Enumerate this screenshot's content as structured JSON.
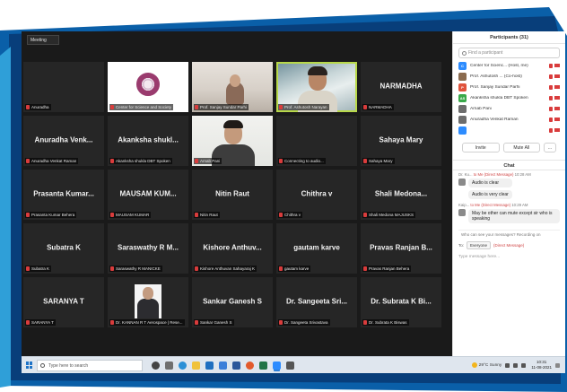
{
  "window": {
    "meeting_info_label": "Meeting"
  },
  "tiles": [
    {
      "name": "",
      "label": "Anuradha",
      "kind": "blank"
    },
    {
      "name": "",
      "label": "Center for Science and Society",
      "kind": "logo"
    },
    {
      "name": "",
      "label": "Prof. Sanjay Sundar Parhi",
      "kind": "video-room"
    },
    {
      "name": "",
      "label": "Prof. Ashutosh Narayan",
      "kind": "video-man",
      "speaking": true
    },
    {
      "name": "NARMADHA",
      "label": "NARMADHA",
      "kind": "name"
    },
    {
      "name": "Anuradha Venk...",
      "label": "Anuradha Venkat Raman",
      "kind": "name"
    },
    {
      "name": "Akanksha shukl...",
      "label": "Akanksha shukla DBT Spoken",
      "kind": "name"
    },
    {
      "name": "",
      "label": "Arnab Pani",
      "kind": "video-arnab"
    },
    {
      "name": "",
      "label": "Connecting to audio...",
      "kind": "blank"
    },
    {
      "name": "Sahaya Mary",
      "label": "Sahaya Mary",
      "kind": "name"
    },
    {
      "name": "Prasanta Kumar...",
      "label": "Prasanta Kumar Behera",
      "kind": "name"
    },
    {
      "name": "MAUSAM KUM...",
      "label": "MAUSAM KUMAR",
      "kind": "name"
    },
    {
      "name": "Nitin Raut",
      "label": "Nitin Raut",
      "kind": "name"
    },
    {
      "name": "Chithra v",
      "label": "Chithra v",
      "kind": "name"
    },
    {
      "name": "Shali Medona...",
      "label": "Shali Medona MAJUSKS",
      "kind": "name"
    },
    {
      "name": "Subatra K",
      "label": "Subatra K",
      "kind": "name"
    },
    {
      "name": "Saraswathy R M...",
      "label": "Saraswathy R MANICKE",
      "kind": "name"
    },
    {
      "name": "Kishore Anthuv...",
      "label": "Kishore Anthuvan Sahayaraj K",
      "kind": "name"
    },
    {
      "name": "gautam karve",
      "label": "gautam karve",
      "kind": "name"
    },
    {
      "name": "Pravas Ranjan B...",
      "label": "Pravas Ranjan Behera",
      "kind": "name"
    },
    {
      "name": "SARANYA T",
      "label": "SARANYA T",
      "kind": "name"
    },
    {
      "name": "",
      "label": "Dr. KANNAN R T Aerospace | Rese...",
      "kind": "photo"
    },
    {
      "name": "Sankar Ganesh S",
      "label": "Sankar Ganesh S",
      "kind": "name"
    },
    {
      "name": "Dr. Sangeeta Sri...",
      "label": "Dr. Sangeeta Srivastava",
      "kind": "name"
    },
    {
      "name": "Dr. Subrata K Bi...",
      "label": "Dr. Subrata K Biswas",
      "kind": "name"
    }
  ],
  "participants_panel": {
    "title": "Participants (31)",
    "search_placeholder": "Find a participant",
    "items": [
      {
        "initials": "C",
        "name": "Center for Scienc... (Host, me)",
        "color": "#2d8cff"
      },
      {
        "initials": "",
        "name": "Prof. Ashutosh ... (Co-host)",
        "color": "#8b6b4f"
      },
      {
        "initials": "P",
        "name": "Prof. Sanjay Sundar Parhi",
        "color": "#e0533c"
      },
      {
        "initials": "AS",
        "name": "Akanksha shukla DBT Spoken",
        "color": "#39a94a"
      },
      {
        "initials": "",
        "name": "Arnab Pani",
        "color": "#6d6d6d"
      },
      {
        "initials": "",
        "name": "Anuradha Venkat Raman",
        "color": "#6d6d6d"
      },
      {
        "initials": "",
        "name": "",
        "color": "#2d8cff"
      }
    ],
    "invite_label": "Invite",
    "mute_all_label": "Mute All",
    "more_label": "..."
  },
  "chat_panel": {
    "title": "Chat",
    "messages": [
      {
        "from": "Dr. Ku...",
        "to": "to Me (Direct Message)",
        "time": "10:28 AM",
        "bubbles": [
          "Audio is clear",
          "Audio is very clear"
        ]
      },
      {
        "from": "Kaip...",
        "to": "to Me (Direct Message)",
        "time": "10:29 AM",
        "bubbles": [
          "May be other can mute except sir who is speaking"
        ]
      }
    ],
    "who_can_see": "Who can see your messages? Recording on",
    "to_label": "To:",
    "to_value": "Everyone",
    "direct_label": "(Direct Message)",
    "input_placeholder": "Type message here..."
  },
  "taskbar": {
    "search_placeholder": "Type here to search",
    "weather": "29°C  Sunny",
    "time": "10:31",
    "date": "11-08-2021"
  }
}
